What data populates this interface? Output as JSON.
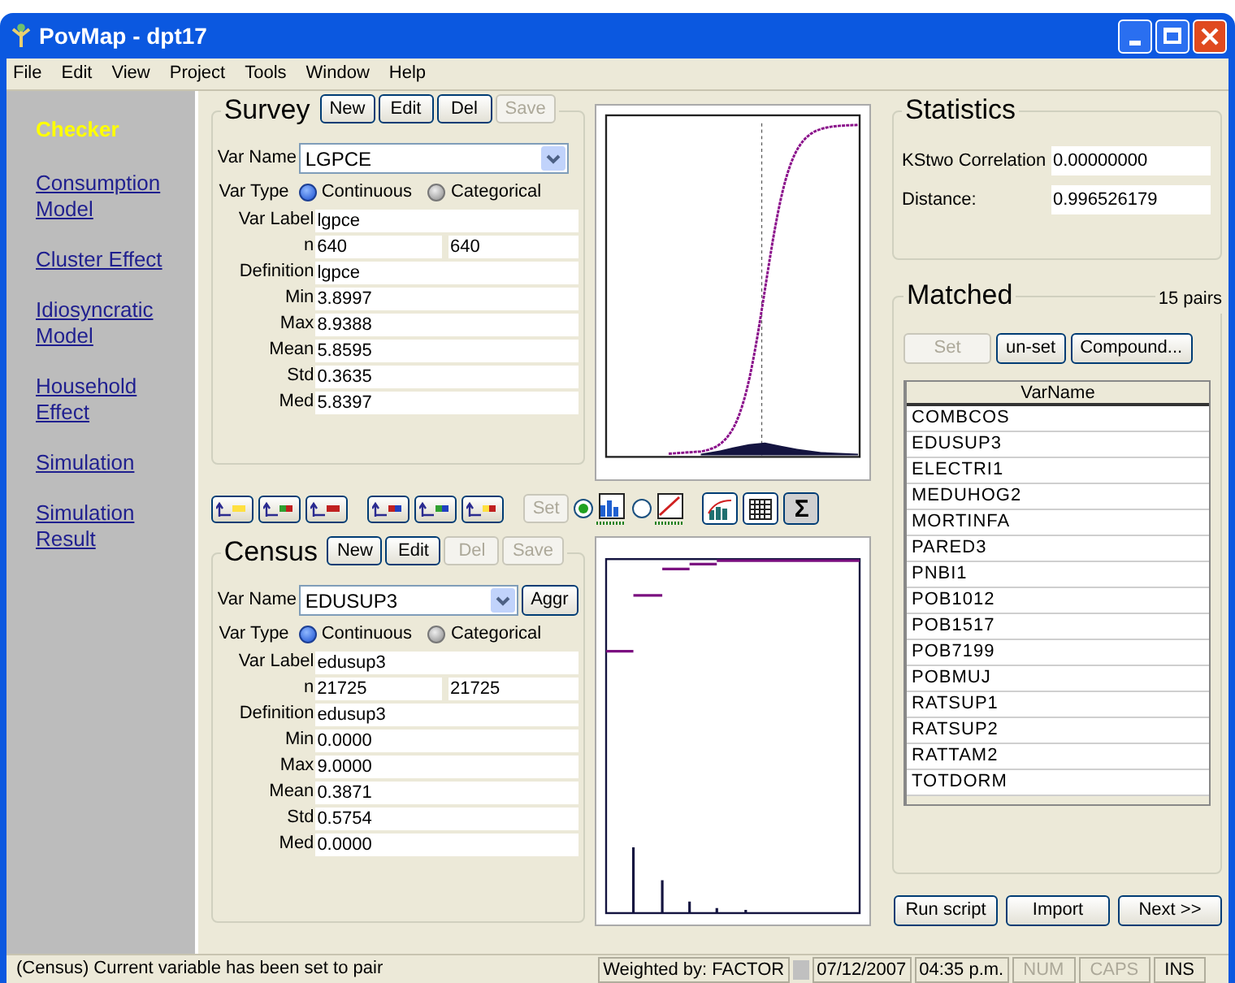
{
  "window": {
    "title": "PovMap - dpt17"
  },
  "menu": [
    "File",
    "Edit",
    "View",
    "Project",
    "Tools",
    "Window",
    "Help"
  ],
  "sidebar": {
    "items": [
      {
        "label": "Checker",
        "selected": true
      },
      {
        "label": "Consumption Model",
        "selected": false
      },
      {
        "label": "Cluster Effect",
        "selected": false
      },
      {
        "label": "Idiosyncratic Model",
        "selected": false
      },
      {
        "label": "Household Effect",
        "selected": false
      },
      {
        "label": "Simulation",
        "selected": false
      },
      {
        "label": "Simulation Result",
        "selected": false
      }
    ]
  },
  "survey": {
    "title": "Survey",
    "buttons": [
      {
        "label": "New",
        "disabled": false
      },
      {
        "label": "Edit",
        "disabled": false
      },
      {
        "label": "Del",
        "disabled": false
      },
      {
        "label": "Save",
        "disabled": true
      }
    ],
    "var_name": {
      "label": "Var Name",
      "value": "LGPCE"
    },
    "var_type": {
      "label": "Var Type",
      "options": [
        {
          "label": "Continuous",
          "selected": true
        },
        {
          "label": "Categorical",
          "selected": false
        }
      ]
    },
    "rows": [
      {
        "label": "Var Label",
        "value": "lgpce"
      },
      {
        "label": "n",
        "value": "640",
        "value_2": "640"
      },
      {
        "label": "Definition",
        "value": "lgpce"
      },
      {
        "label": "Min",
        "value": "3.8997"
      },
      {
        "label": "Max",
        "value": "8.9388"
      },
      {
        "label": "Mean",
        "value": "5.8595"
      },
      {
        "label": "Std",
        "value": "0.3635"
      },
      {
        "label": "Med",
        "value": "5.8397"
      }
    ]
  },
  "toolbar": {
    "set_button": {
      "label": "Set",
      "disabled": true
    },
    "chart_modes": [
      {
        "selected": true
      },
      {
        "selected": false
      }
    ],
    "sigma_button": "Σ"
  },
  "census": {
    "title": "Census",
    "buttons": [
      {
        "label": "New",
        "disabled": false
      },
      {
        "label": "Edit",
        "disabled": false
      },
      {
        "label": "Del",
        "disabled": true
      },
      {
        "label": "Save",
        "disabled": true
      }
    ],
    "var_name": {
      "label": "Var Name",
      "value": "EDUSUP3",
      "aggr": "Aggr"
    },
    "var_type": {
      "label": "Var Type",
      "options": [
        {
          "label": "Continuous",
          "selected": true
        },
        {
          "label": "Categorical",
          "selected": false
        }
      ]
    },
    "rows": [
      {
        "label": "Var Label",
        "value": "edusup3"
      },
      {
        "label": "n",
        "value": "21725",
        "value_2": "21725"
      },
      {
        "label": "Definition",
        "value": "edusup3"
      },
      {
        "label": "Min",
        "value": "0.0000"
      },
      {
        "label": "Max",
        "value": "9.0000"
      },
      {
        "label": "Mean",
        "value": "0.3871"
      },
      {
        "label": "Std",
        "value": "0.5754"
      },
      {
        "label": "Med",
        "value": "0.0000"
      }
    ]
  },
  "statistics": {
    "title": "Statistics",
    "rows": [
      {
        "label": "KStwo Correlation",
        "value": "0.00000000"
      },
      {
        "label": "Distance:",
        "value": "0.996526179"
      }
    ]
  },
  "matched": {
    "title": "Matched",
    "count": "15 pairs",
    "buttons": [
      {
        "label": "Set",
        "disabled": true
      },
      {
        "label": "un-set",
        "disabled": false
      },
      {
        "label": "Compound...",
        "disabled": false
      }
    ],
    "table": {
      "columns": [
        "VarName"
      ],
      "rows": [
        "COMBCOS",
        "EDUSUP3",
        "ELECTRI1",
        "MEDUHOG2",
        "MORTINFA",
        "PARED3",
        "PNBI1",
        "POB1012",
        "POB1517",
        "POB7199",
        "POBMUJ",
        "RATSUP1",
        "RATSUP2",
        "RATTAM2",
        "TOTDORM"
      ]
    }
  },
  "actions": [
    "Run script",
    "Import",
    "Next >>"
  ],
  "status_bar": {
    "message": "(Census) Current variable has been set to pair",
    "weighted": "Weighted by: FACTOR",
    "date": "07/12/2007",
    "time": "04:35 p.m.",
    "indicators": [
      {
        "label": "NUM",
        "disabled": true
      },
      {
        "label": "CAPS",
        "disabled": true
      },
      {
        "label": "INS",
        "disabled": false
      }
    ]
  }
}
